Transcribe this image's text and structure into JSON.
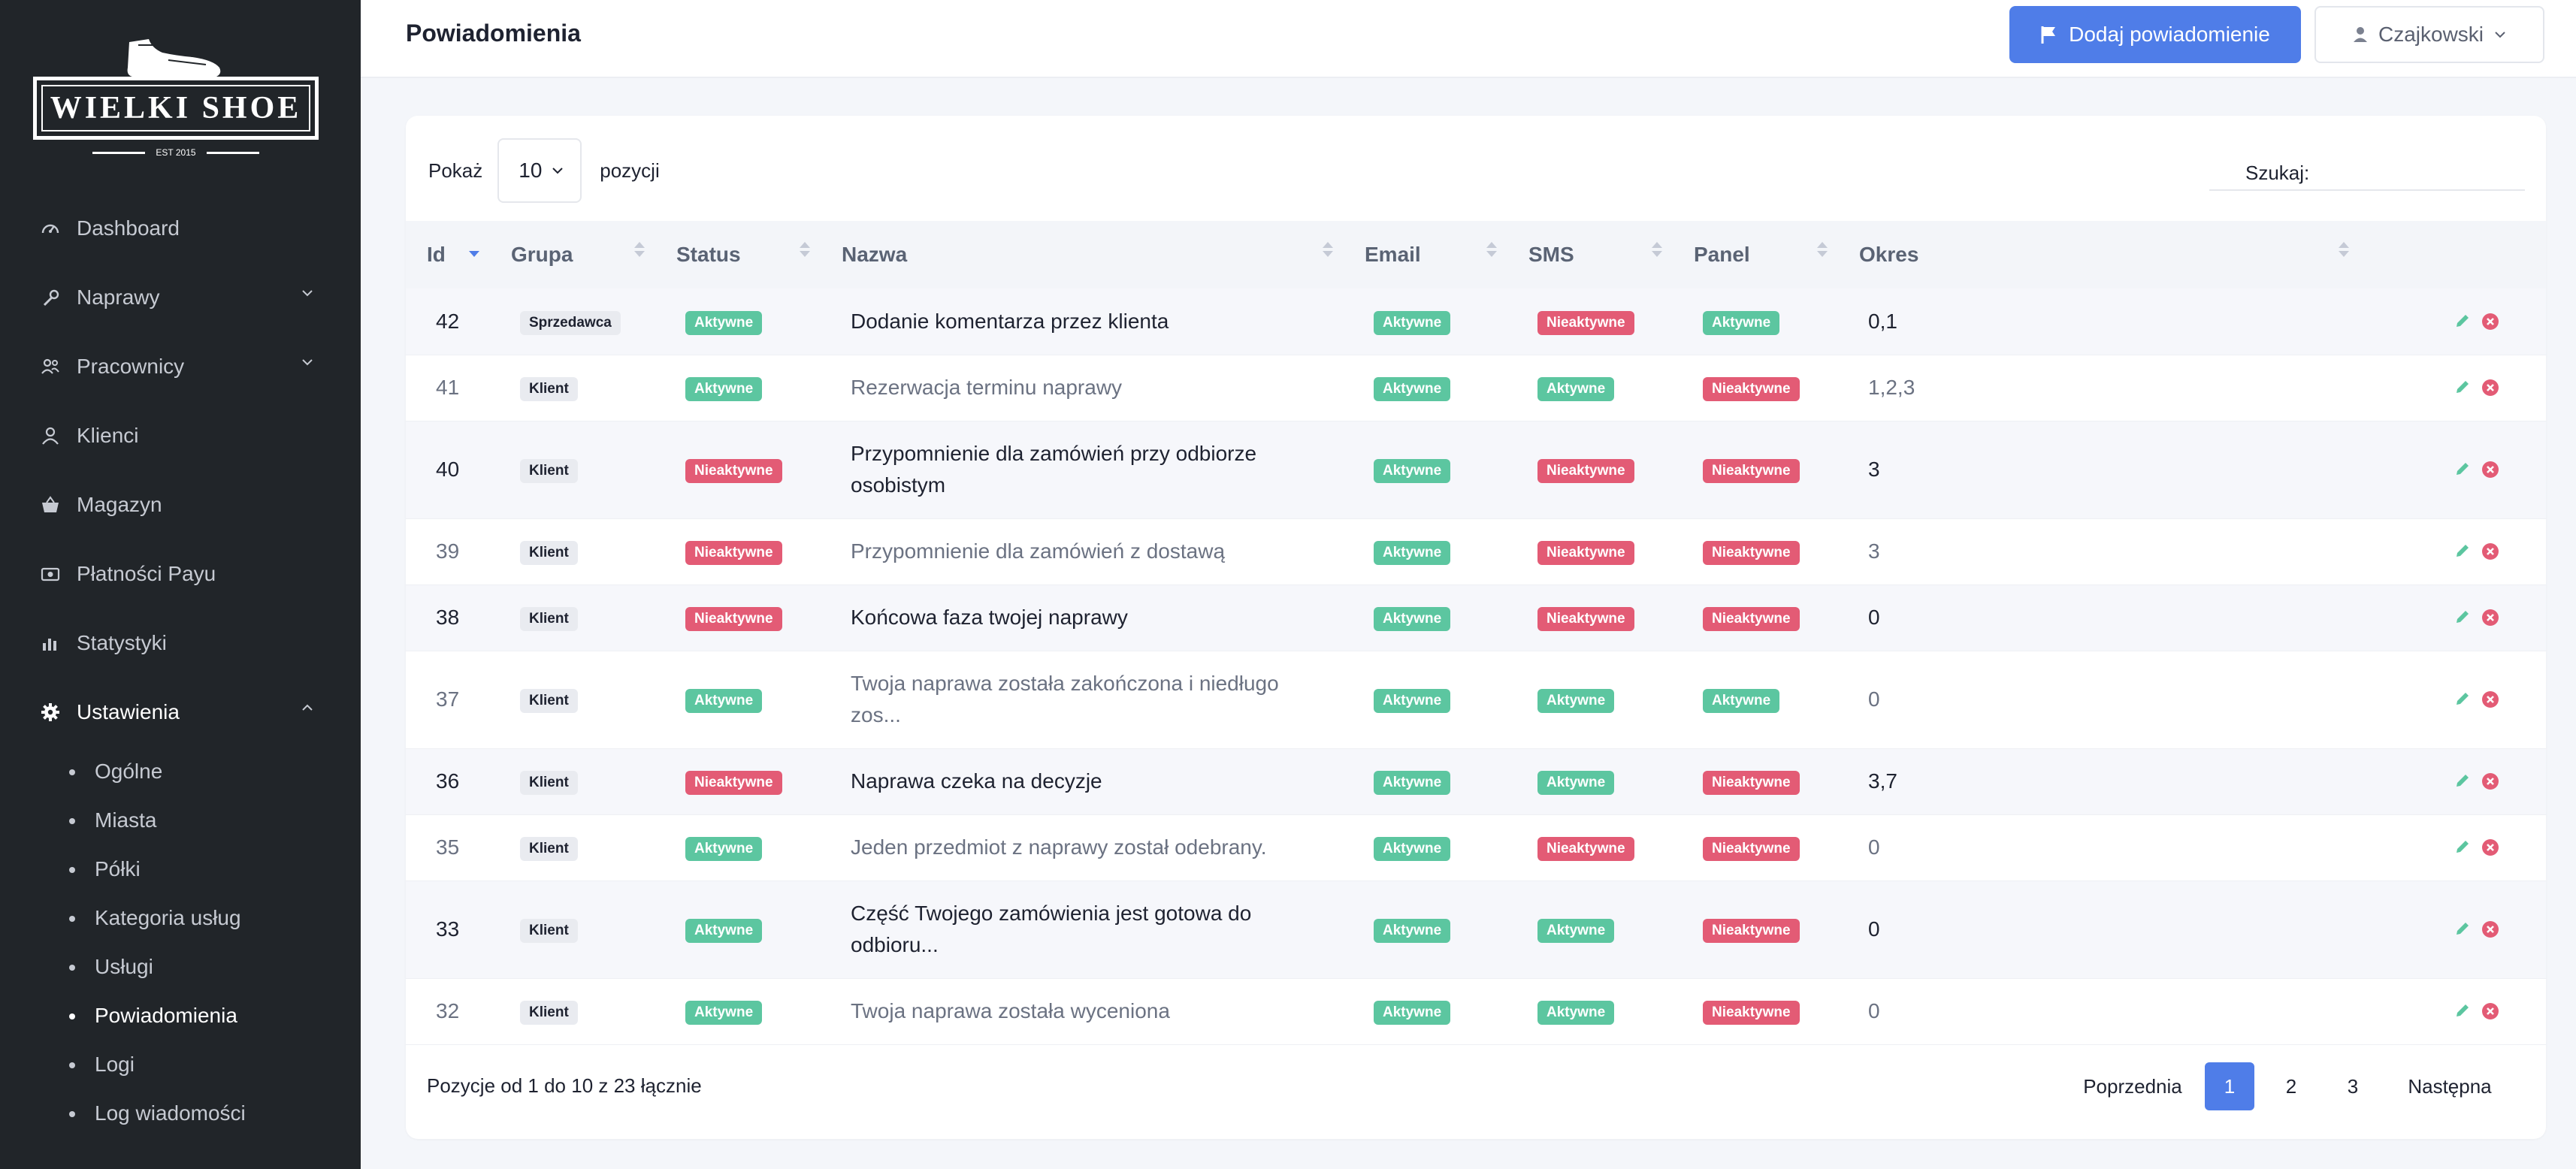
{
  "brand": {
    "name": "WIELKI SHOE",
    "est": "EST 2015"
  },
  "sidebar": {
    "items": [
      {
        "label": "Dashboard",
        "icon": "gauge-icon"
      },
      {
        "label": "Naprawy",
        "icon": "wrench-icon",
        "expandable": true
      },
      {
        "label": "Pracownicy",
        "icon": "users-icon",
        "expandable": true
      },
      {
        "label": "Klienci",
        "icon": "user-icon"
      },
      {
        "label": "Magazyn",
        "icon": "basket-icon"
      },
      {
        "label": "Płatności Payu",
        "icon": "money-icon"
      },
      {
        "label": "Statystyki",
        "icon": "chart-icon"
      },
      {
        "label": "Ustawienia",
        "icon": "gear-icon",
        "expandable": true,
        "expanded": true
      }
    ],
    "sub_items": [
      "Ogólne",
      "Miasta",
      "Półki",
      "Kategoria usług",
      "Usługi",
      "Powiadomienia",
      "Logi",
      "Log wiadomości"
    ],
    "active_sub": "Powiadomienia"
  },
  "header": {
    "title": "Powiadomienia",
    "add_button": "Dodaj powiadomienie",
    "user": "Czajkowski"
  },
  "table_controls": {
    "show_label": "Pokaż",
    "show_value": "10",
    "show_suffix": "pozycji",
    "search_label": "Szukaj:",
    "search_value": ""
  },
  "table": {
    "columns": [
      "Id",
      "Grupa",
      "Status",
      "Nazwa",
      "Email",
      "SMS",
      "Panel",
      "Okres"
    ],
    "rows": [
      {
        "id": "42",
        "group": "Sprzedawca",
        "status": "Aktywne",
        "name": "Dodanie komentarza przez klienta",
        "email": "Aktywne",
        "sms": "Nieaktywne",
        "panel": "Aktywne",
        "period": "0,1"
      },
      {
        "id": "41",
        "group": "Klient",
        "status": "Aktywne",
        "name": "Rezerwacja terminu naprawy",
        "email": "Aktywne",
        "sms": "Aktywne",
        "panel": "Nieaktywne",
        "period": "1,2,3"
      },
      {
        "id": "40",
        "group": "Klient",
        "status": "Nieaktywne",
        "name": "Przypomnienie dla zamówień przy odbiorze osobistym",
        "email": "Aktywne",
        "sms": "Nieaktywne",
        "panel": "Nieaktywne",
        "period": "3"
      },
      {
        "id": "39",
        "group": "Klient",
        "status": "Nieaktywne",
        "name": "Przypomnienie dla zamówień z dostawą",
        "email": "Aktywne",
        "sms": "Nieaktywne",
        "panel": "Nieaktywne",
        "period": "3"
      },
      {
        "id": "38",
        "group": "Klient",
        "status": "Nieaktywne",
        "name": "Końcowa faza twojej naprawy",
        "email": "Aktywne",
        "sms": "Nieaktywne",
        "panel": "Nieaktywne",
        "period": "0"
      },
      {
        "id": "37",
        "group": "Klient",
        "status": "Aktywne",
        "name": "Twoja naprawa została zakończona i niedługo zos...",
        "email": "Aktywne",
        "sms": "Aktywne",
        "panel": "Aktywne",
        "period": "0"
      },
      {
        "id": "36",
        "group": "Klient",
        "status": "Nieaktywne",
        "name": "Naprawa czeka na decyzje",
        "email": "Aktywne",
        "sms": "Aktywne",
        "panel": "Nieaktywne",
        "period": "3,7"
      },
      {
        "id": "35",
        "group": "Klient",
        "status": "Aktywne",
        "name": "Jeden przedmiot z naprawy został odebrany.",
        "email": "Aktywne",
        "sms": "Nieaktywne",
        "panel": "Nieaktywne",
        "period": "0"
      },
      {
        "id": "33",
        "group": "Klient",
        "status": "Aktywne",
        "name": "Część Twojego zamówienia jest gotowa do odbioru...",
        "email": "Aktywne",
        "sms": "Aktywne",
        "panel": "Nieaktywne",
        "period": "0"
      },
      {
        "id": "32",
        "group": "Klient",
        "status": "Aktywne",
        "name": "Twoja naprawa została wyceniona",
        "email": "Aktywne",
        "sms": "Aktywne",
        "panel": "Nieaktywne",
        "period": "0"
      }
    ]
  },
  "footer": {
    "info": "Pozycje od 1 do 10 z 23 łącznie",
    "prev": "Poprzednia",
    "pages": [
      "1",
      "2",
      "3"
    ],
    "active_page": "1",
    "next": "Następna"
  },
  "colors": {
    "accent": "#4f7de8",
    "active_badge": "#5cc6a0",
    "inactive_badge": "#e35b75",
    "sidebar_bg": "#212529"
  }
}
